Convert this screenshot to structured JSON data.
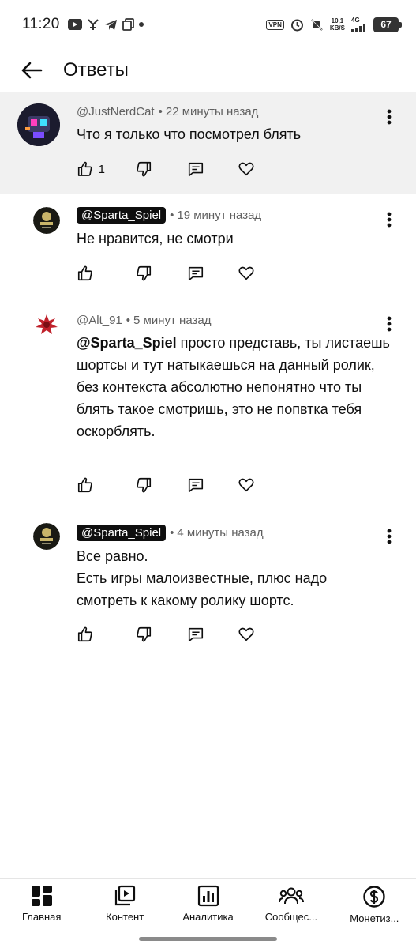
{
  "status_bar": {
    "time": "11:20",
    "vpn_label": "VPN",
    "speed_value": "10,1",
    "speed_unit": "KB/S",
    "network": "4G",
    "battery": "67"
  },
  "header": {
    "title": "Ответы"
  },
  "comments": [
    {
      "author": "@JustNerdCat",
      "time": "22 минуты назад",
      "text": "Что я только что посмотрел блять",
      "likes": "1"
    },
    {
      "author": "@Sparta_Spiel",
      "time": "19 минут назад",
      "text": "Не нравится, не смотри"
    },
    {
      "author": "@Alt_91",
      "time": "5 минут назад",
      "mention": "@Sparta_Spiel",
      "text": " просто представь, ты листаешь шортсы и тут натыкаешься на данный ролик, без контекста абсолютно непонятно что ты блять такое смотришь, это не попвтка тебя оскорблять."
    },
    {
      "author": "@Sparta_Spiel",
      "time": "4 минуты назад",
      "lines": [
        "Все равно.",
        "Есть игры малоизвестные, плюс надо смотреть к какому ролику шортс."
      ]
    }
  ],
  "bottom_nav": [
    {
      "label": "Главная",
      "icon": "dashboard-icon"
    },
    {
      "label": "Контент",
      "icon": "content-library-icon"
    },
    {
      "label": "Аналитика",
      "icon": "analytics-icon"
    },
    {
      "label": "Сообщес...",
      "icon": "community-icon"
    },
    {
      "label": "Монетиз...",
      "icon": "monetization-icon"
    }
  ]
}
